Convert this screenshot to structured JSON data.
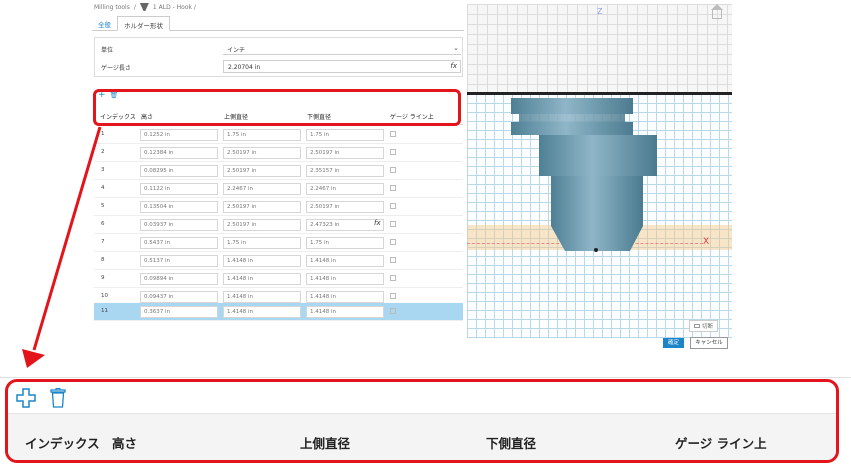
{
  "breadcrumb": {
    "root": "Milling tools",
    "sep1": "/",
    "current": "1 ALD - Hook /"
  },
  "tabs": [
    {
      "label": "全般"
    },
    {
      "label": "ホルダー形状"
    }
  ],
  "properties": {
    "unit_label": "単位",
    "unit_value": "インチ",
    "gauge_label": "ゲージ長さ",
    "gauge_value": "2.20704 in",
    "fx": "fx"
  },
  "toolbar": {
    "add_glyph": "+",
    "delete_glyph": "🗑"
  },
  "columns": {
    "index": "インデックス",
    "height": "高さ",
    "upper": "上側直径",
    "lower": "下側直径",
    "gauge": "ゲージ ライン上"
  },
  "rows": [
    {
      "index": "1",
      "height": "0.1252 in",
      "upper": "1.75 in",
      "lower": "1.75 in"
    },
    {
      "index": "2",
      "height": "0.12384 in",
      "upper": "2.50197 in",
      "lower": "2.50197 in"
    },
    {
      "index": "3",
      "height": "0.08295 in",
      "upper": "2.50197 in",
      "lower": "2.35157 in"
    },
    {
      "index": "4",
      "height": "0.1122 in",
      "upper": "2.2467 in",
      "lower": "2.2467 in"
    },
    {
      "index": "5",
      "height": "0.13504 in",
      "upper": "2.50197 in",
      "lower": "2.50197 in"
    },
    {
      "index": "6",
      "height": "0.03937 in",
      "upper": "2.50197 in",
      "lower": "2.47323 in"
    },
    {
      "index": "7",
      "height": "0.5437 in",
      "upper": "1.75 in",
      "lower": "1.75 in"
    },
    {
      "index": "8",
      "height": "0.5137 in",
      "upper": "1.4148 in",
      "lower": "1.4148 in"
    },
    {
      "index": "9",
      "height": "0.09894 in",
      "upper": "1.4148 in",
      "lower": "1.4148 in"
    },
    {
      "index": "10",
      "height": "0.09437 in",
      "upper": "1.4148 in",
      "lower": "1.4148 in"
    },
    {
      "index": "11",
      "height": "0.3637 in",
      "upper": "1.4148 in",
      "lower": "1.4148 in"
    }
  ],
  "viewport": {
    "z_axis": "Z",
    "x_axis": "X",
    "clip_label": "切断",
    "body_color": "#5f8ea3"
  },
  "buttons": {
    "ok": "確定",
    "cancel": "キャンセル"
  },
  "accent_color": "#1c85c8",
  "callout_color": "#e3141b"
}
